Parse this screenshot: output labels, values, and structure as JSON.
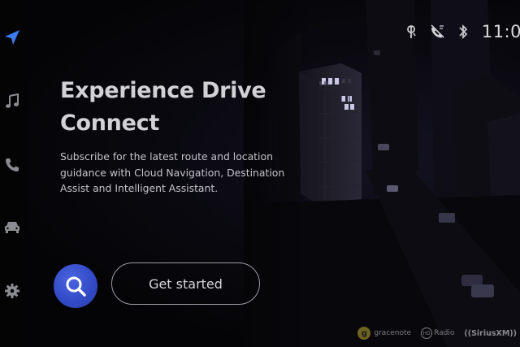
{
  "status_bar": {
    "time": "11:0",
    "icons": [
      "voice-assistant-icon",
      "phone-muted-icon",
      "bluetooth-icon"
    ]
  },
  "sidebar": {
    "items": [
      {
        "icon": "navigation-arrow-icon",
        "color": "#3a7bf0",
        "active": true
      },
      {
        "icon": "music-note-icon",
        "color": "#8b8b92",
        "active": false
      },
      {
        "icon": "phone-icon",
        "color": "#8b8b92",
        "active": false
      },
      {
        "icon": "car-icon",
        "color": "#8b8b92",
        "active": false
      },
      {
        "icon": "gear-icon",
        "color": "#8b8b92",
        "active": false
      }
    ]
  },
  "promo": {
    "title_line1": "Experience Drive",
    "title_line2": "Connect",
    "description_line1": "Subscribe for the latest route and location",
    "description_line2": "guidance with Cloud Navigation, Destination",
    "description_line3": "Assist and Intelligent Assistant."
  },
  "actions": {
    "search_icon": "search-icon",
    "get_started_label": "Get started"
  },
  "partners": {
    "gracenote": "gracenote",
    "hdradio": "Radio",
    "siriusxm": "((SiriusXM))"
  },
  "colors": {
    "accent_blue": "#3a7bf0",
    "search_button": "#3a51cc",
    "background": "#050507",
    "text_primary": "#d2d2d6"
  }
}
